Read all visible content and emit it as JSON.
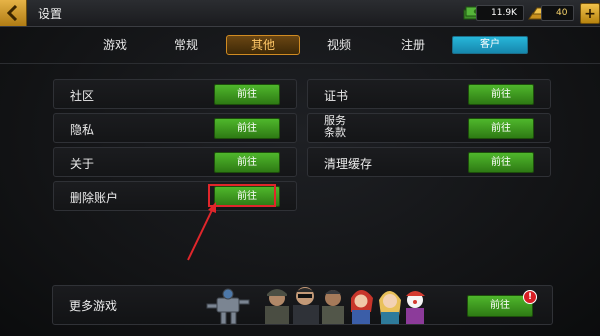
{
  "header": {
    "title": "设置",
    "cash": "11.9K",
    "gold": "40",
    "plus": "+"
  },
  "tabs": [
    {
      "label": "游戏"
    },
    {
      "label": "常规"
    },
    {
      "label": "其他",
      "active": true
    },
    {
      "label": "视频"
    },
    {
      "label": "注册"
    },
    {
      "label": "客户"
    }
  ],
  "left_rows": [
    {
      "label": "社区",
      "button": "前往"
    },
    {
      "label": "隐私",
      "button": "前往"
    },
    {
      "label": "关于",
      "button": "前往"
    },
    {
      "label": "删除账户",
      "button": "前往"
    }
  ],
  "right_rows": [
    {
      "label": "证书",
      "button": "前往"
    },
    {
      "label": "服务\n条款",
      "button": "前往"
    },
    {
      "label": "清理缓存",
      "button": "前往"
    }
  ],
  "more_games": {
    "label": "更多游戏",
    "button": "前往",
    "alert": "!"
  },
  "colors": {
    "accent_gold": "#d08b22",
    "button_green": "#4fb72c",
    "customer_blue": "#27b6d9",
    "highlight_red": "#e0262b"
  }
}
